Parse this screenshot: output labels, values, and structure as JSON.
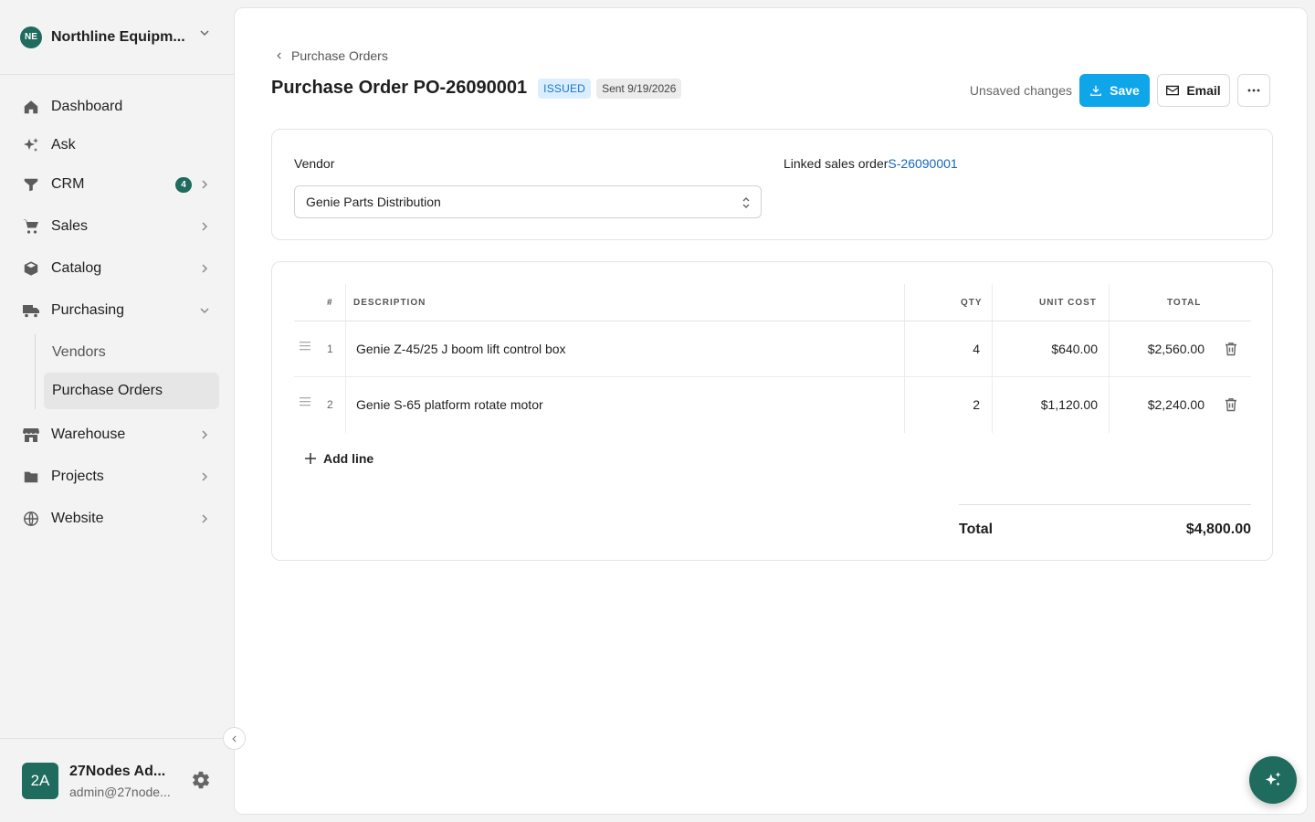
{
  "org": {
    "initials": "NE",
    "name": "Northline Equipm..."
  },
  "nav": {
    "dashboard": "Dashboard",
    "ask": "Ask",
    "crm": "CRM",
    "crm_badge": "4",
    "sales": "Sales",
    "catalog": "Catalog",
    "purchasing": "Purchasing",
    "vendors": "Vendors",
    "purchase_orders": "Purchase Orders",
    "warehouse": "Warehouse",
    "projects": "Projects",
    "website": "Website"
  },
  "user": {
    "initials": "2A",
    "name": "27Nodes Ad...",
    "email": "admin@27node..."
  },
  "header": {
    "breadcrumb": "Purchase Orders",
    "title": "Purchase Order PO-26090001",
    "status": "ISSUED",
    "sent": "Sent 9/19/2026",
    "unsaved": "Unsaved changes",
    "save_label": "Save",
    "email_label": "Email"
  },
  "details": {
    "vendor_label": "Vendor",
    "vendor_value": "Genie Parts Distribution",
    "linked_label": "Linked sales order",
    "linked_value": "S-26090001"
  },
  "table": {
    "headers": {
      "num": "#",
      "description": "DESCRIPTION",
      "qty": "QTY",
      "unit_cost": "UNIT COST",
      "total": "TOTAL"
    },
    "rows": [
      {
        "num": "1",
        "description": "Genie Z-45/25 J boom lift control box",
        "qty": "4",
        "unit_cost": "$640.00",
        "total": "$2,560.00"
      },
      {
        "num": "2",
        "description": "Genie S-65 platform rotate motor",
        "qty": "2",
        "unit_cost": "$1,120.00",
        "total": "$2,240.00"
      }
    ],
    "add_line": "Add line",
    "total_label": "Total",
    "total_value": "$4,800.00"
  },
  "colors": {
    "accent": "#0ea5e9",
    "brand": "#1f6b5e",
    "link": "#1565c0"
  }
}
